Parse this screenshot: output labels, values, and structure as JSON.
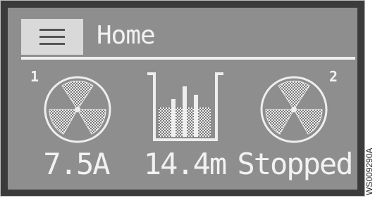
{
  "header": {
    "menu_icon": "hamburger-menu-icon",
    "title": "Home"
  },
  "panels": [
    {
      "index": "1",
      "icon": "fan-icon",
      "value": "7.5A"
    },
    {
      "index": "",
      "icon": "tank-level-icon",
      "value": "14.4m"
    },
    {
      "index": "2",
      "icon": "fan-icon",
      "value": "Stopped"
    }
  ],
  "watermark": "WS009290A",
  "colors": {
    "screen": "#8e8e8e",
    "frame": "#3b3b3b",
    "menu_button": "#d9d9d9",
    "foreground": "#f2f2f2"
  }
}
